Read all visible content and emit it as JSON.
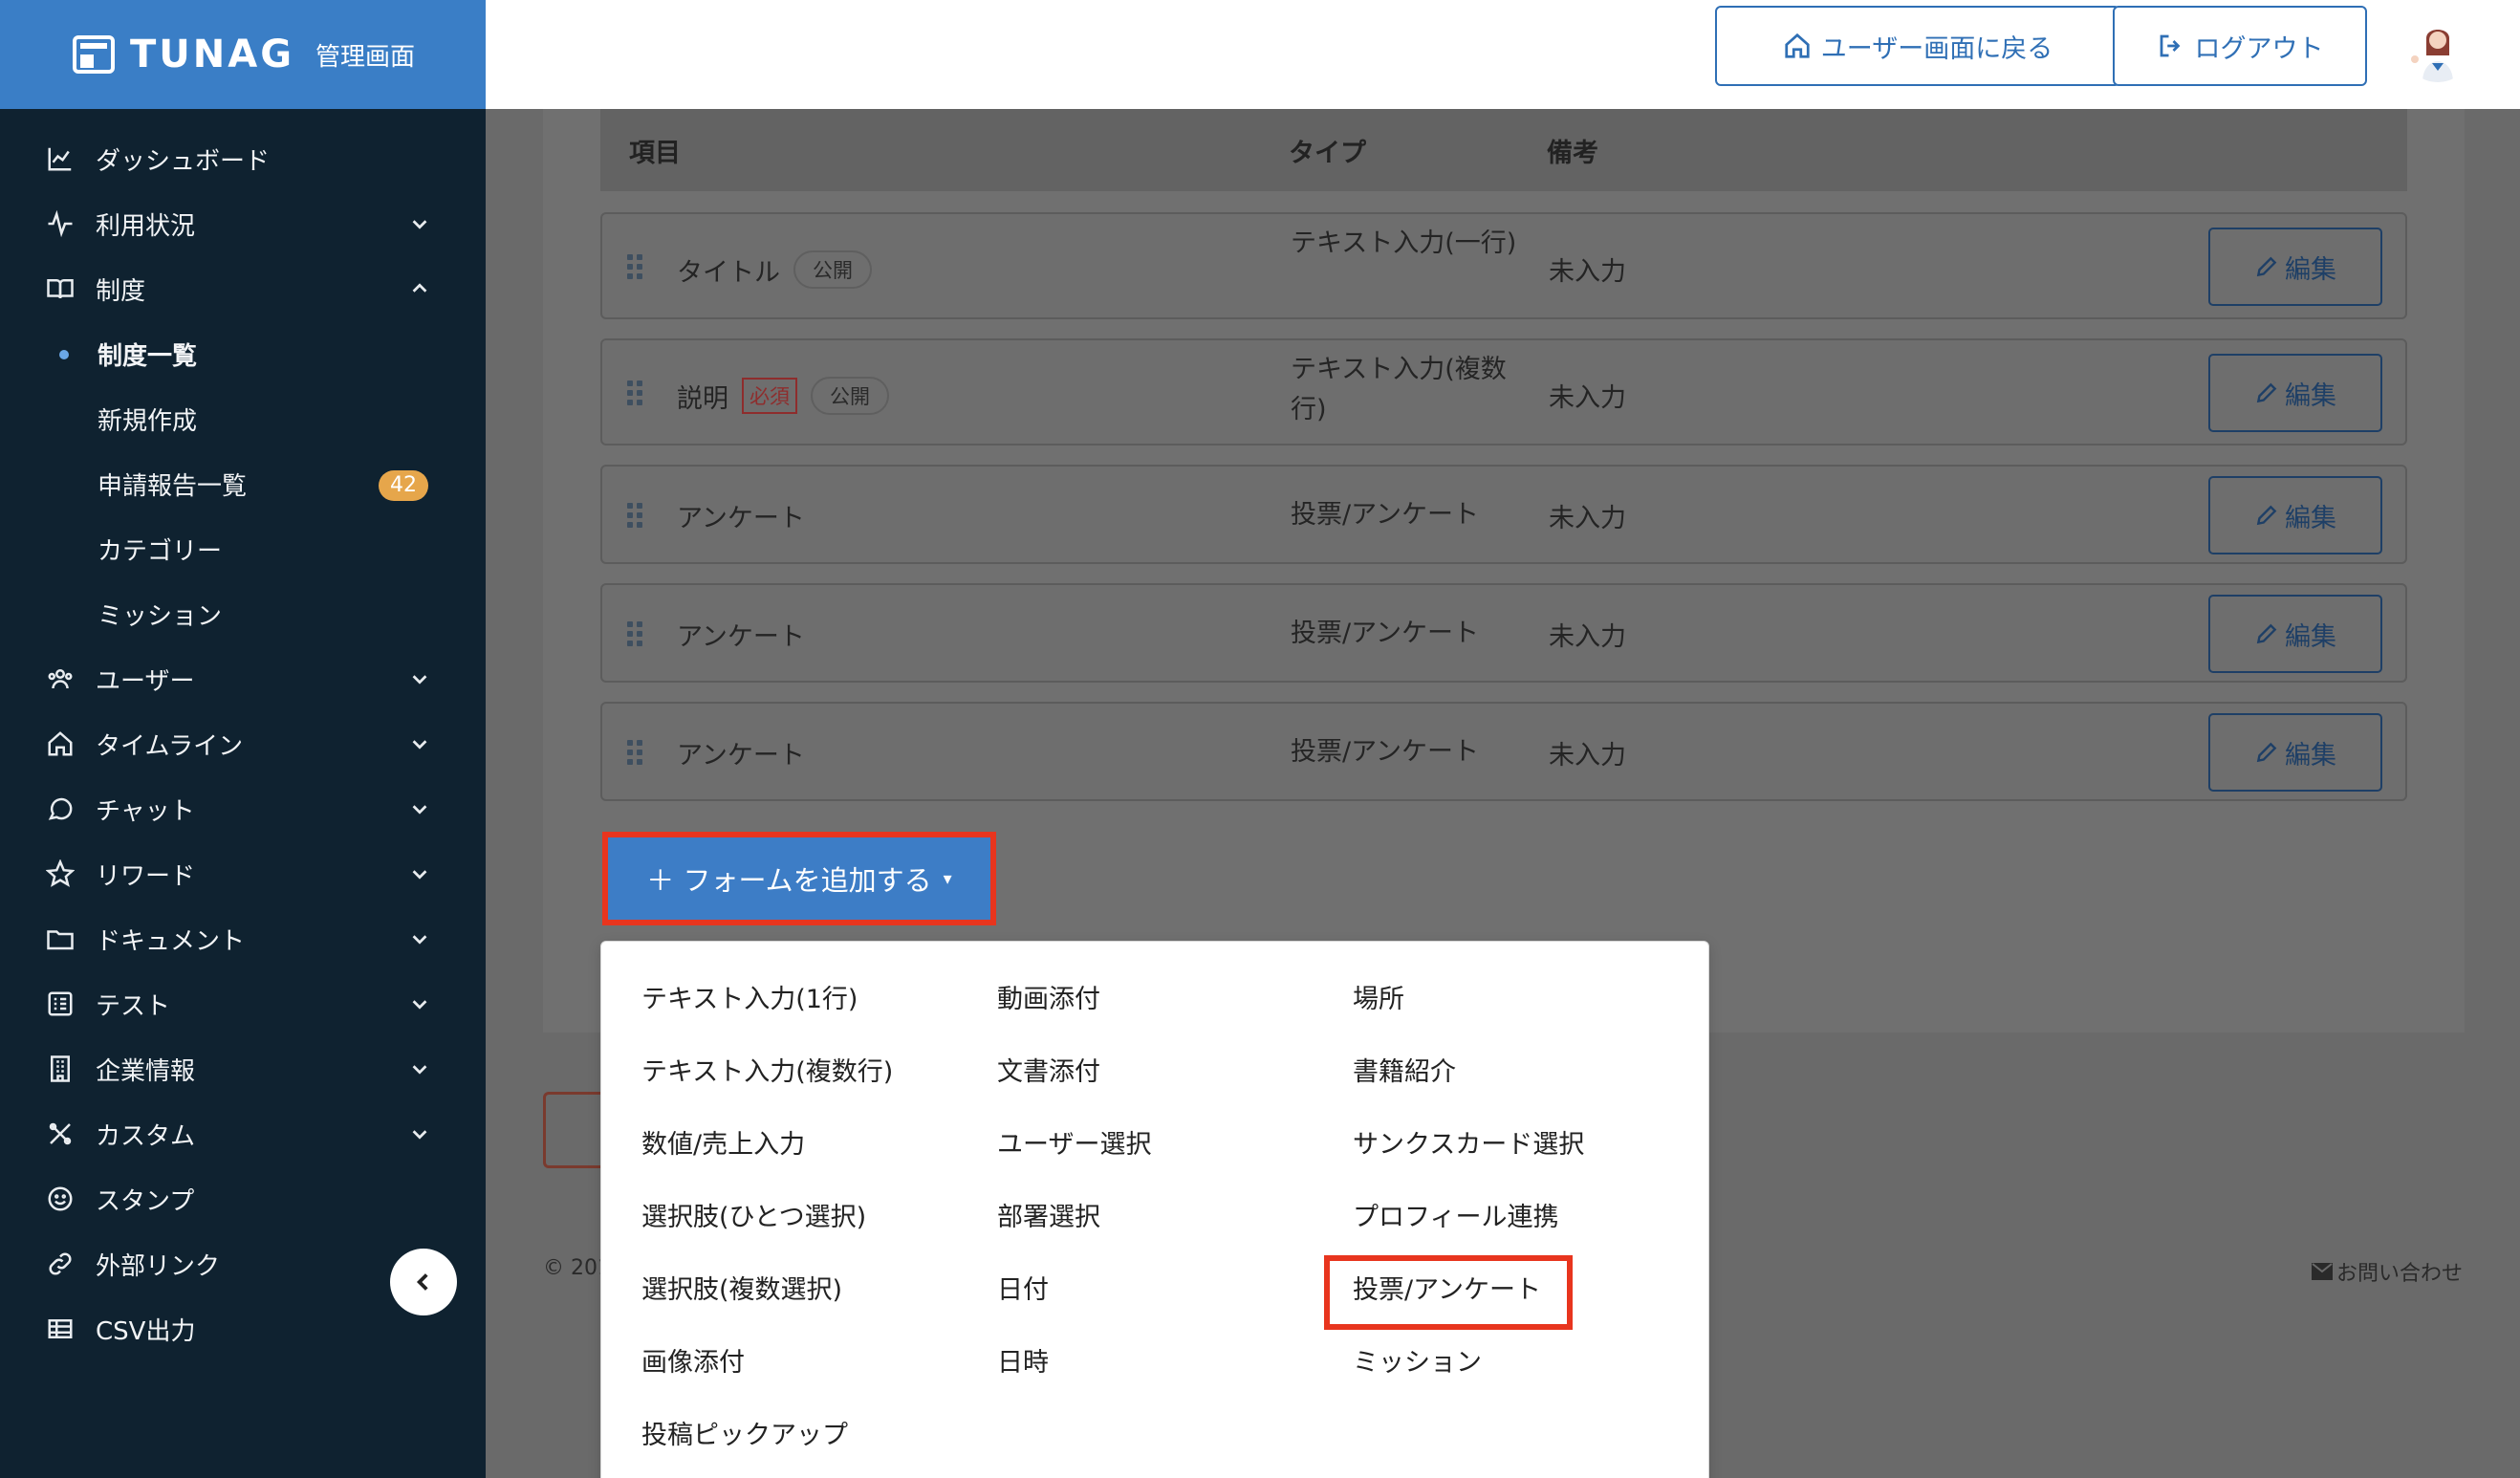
{
  "brand": {
    "logo": "TUNAG",
    "admin_label": "管理画面"
  },
  "sidebar": {
    "items": [
      {
        "label": "ダッシュボード",
        "icon": "chart-line-icon"
      },
      {
        "label": "利用状況",
        "icon": "pulse-icon",
        "expandable": true
      },
      {
        "label": "制度",
        "icon": "book-icon",
        "expanded": true,
        "children": [
          {
            "label": "制度一覧",
            "active": true
          },
          {
            "label": "新規作成"
          },
          {
            "label": "申請報告一覧",
            "badge": "42"
          },
          {
            "label": "カテゴリー"
          },
          {
            "label": "ミッション"
          }
        ]
      },
      {
        "label": "ユーザー",
        "icon": "users-icon",
        "expandable": true
      },
      {
        "label": "タイムライン",
        "icon": "home-icon",
        "expandable": true
      },
      {
        "label": "チャット",
        "icon": "chat-icon",
        "expandable": true
      },
      {
        "label": "リワード",
        "icon": "star-icon",
        "expandable": true
      },
      {
        "label": "ドキュメント",
        "icon": "folder-icon",
        "expandable": true
      },
      {
        "label": "テスト",
        "icon": "checklist-icon",
        "expandable": true
      },
      {
        "label": "企業情報",
        "icon": "building-icon",
        "expandable": true
      },
      {
        "label": "カスタム",
        "icon": "tools-icon",
        "expandable": true
      },
      {
        "label": "スタンプ",
        "icon": "smile-icon"
      },
      {
        "label": "外部リンク",
        "icon": "link-icon"
      },
      {
        "label": "CSV出力",
        "icon": "table-icon"
      }
    ]
  },
  "topbar": {
    "back_label": "ユーザー画面に戻る",
    "logout_label": "ログアウト"
  },
  "table": {
    "headers": {
      "item": "項目",
      "type": "タイプ",
      "note": "備考"
    },
    "rows": [
      {
        "name": "タイトル",
        "tags": [
          "公開"
        ],
        "type": "テキスト入力(一行)",
        "note": "未入力",
        "edit": "編集"
      },
      {
        "name": "説明",
        "required": "必須",
        "tags": [
          "公開"
        ],
        "type": "テキスト入力(複数行)",
        "note": "未入力",
        "edit": "編集"
      },
      {
        "name": "アンケート",
        "type": "投票/アンケート",
        "note": "未入力",
        "edit": "編集"
      },
      {
        "name": "アンケート",
        "type": "投票/アンケート",
        "note": "未入力",
        "edit": "編集"
      },
      {
        "name": "アンケート",
        "type": "投票/アンケート",
        "note": "未入力",
        "edit": "編集"
      }
    ]
  },
  "add_form": {
    "label": "＋ フォームを追加する",
    "caret": "▾"
  },
  "dropdown": {
    "col1": [
      "テキスト入力(1行)",
      "テキスト入力(複数行)",
      "数値/売上入力",
      "選択肢(ひとつ選択)",
      "選択肢(複数選択)",
      "画像添付",
      "投稿ピックアップ"
    ],
    "col2": [
      "動画添付",
      "文書添付",
      "ユーザー選択",
      "部署選択",
      "日付",
      "日時"
    ],
    "col3": [
      "場所",
      "書籍紹介",
      "サンクスカード選択",
      "プロフィール連携",
      "投票/アンケート",
      "ミッション"
    ]
  },
  "footer": {
    "copyright": "© 201",
    "contact": "お問い合わせ"
  },
  "colors": {
    "brand": "#3a7ec6",
    "sidebar": "#0f2230",
    "highlight": "#e8351e",
    "badge": "#e6a64b"
  }
}
